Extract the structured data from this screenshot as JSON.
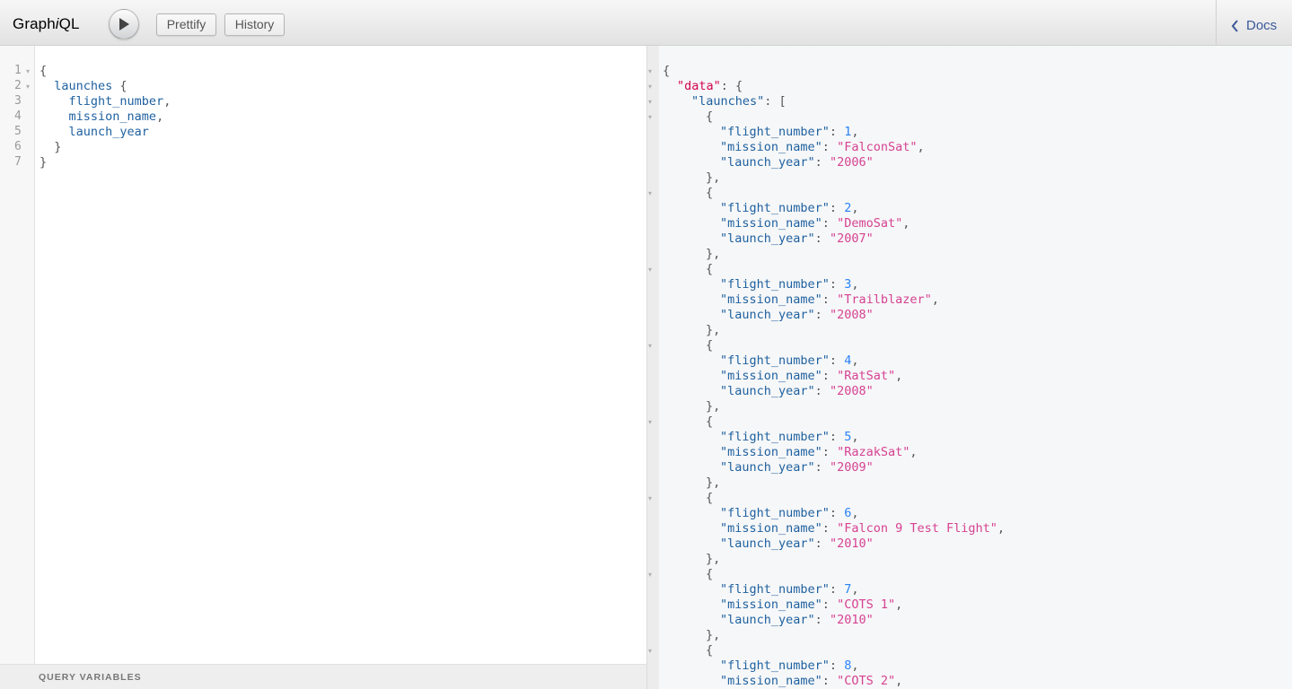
{
  "toolbar": {
    "logo_prefix": "Graph",
    "logo_italic": "i",
    "logo_suffix": "QL",
    "prettify_label": "Prettify",
    "history_label": "History",
    "docs_label": "Docs"
  },
  "query_editor": {
    "line_numbers": [
      "1",
      "2",
      "3",
      "4",
      "5",
      "6",
      "7"
    ],
    "lines": [
      {
        "indent": "",
        "field": "",
        "punct": "{"
      },
      {
        "indent": "  ",
        "field": "launches",
        "punct": " {"
      },
      {
        "indent": "    ",
        "field": "flight_number",
        "punct": ","
      },
      {
        "indent": "    ",
        "field": "mission_name",
        "punct": ","
      },
      {
        "indent": "    ",
        "field": "launch_year",
        "punct": ""
      },
      {
        "indent": "  ",
        "field": "",
        "punct": "}"
      },
      {
        "indent": "",
        "field": "",
        "punct": "}"
      }
    ]
  },
  "query_variables": {
    "title": "QUERY VARIABLES"
  },
  "result": {
    "data_key": "\"data\"",
    "list_key": "\"launches\"",
    "keys": {
      "flight_number": "\"flight_number\"",
      "mission_name": "\"mission_name\"",
      "launch_year": "\"launch_year\""
    },
    "launches": [
      {
        "flight_number": "1",
        "mission_name": "\"FalconSat\"",
        "launch_year": "\"2006\""
      },
      {
        "flight_number": "2",
        "mission_name": "\"DemoSat\"",
        "launch_year": "\"2007\""
      },
      {
        "flight_number": "3",
        "mission_name": "\"Trailblazer\"",
        "launch_year": "\"2008\""
      },
      {
        "flight_number": "4",
        "mission_name": "\"RatSat\"",
        "launch_year": "\"2008\""
      },
      {
        "flight_number": "5",
        "mission_name": "\"RazakSat\"",
        "launch_year": "\"2009\""
      },
      {
        "flight_number": "6",
        "mission_name": "\"Falcon 9 Test Flight\"",
        "launch_year": "\"2010\""
      },
      {
        "flight_number": "7",
        "mission_name": "\"COTS 1\"",
        "launch_year": "\"2010\""
      },
      {
        "flight_number": "8",
        "mission_name": "\"COTS 2\"",
        "launch_year": ""
      }
    ]
  },
  "colors": {
    "field": "#1f61a0",
    "string": "#d64292",
    "number": "#2882f9",
    "data_key": "#d2054e",
    "docs_link": "#3b5998"
  },
  "icons": [
    "play-icon",
    "chevron-left-icon",
    "fold-arrow-icon"
  ]
}
